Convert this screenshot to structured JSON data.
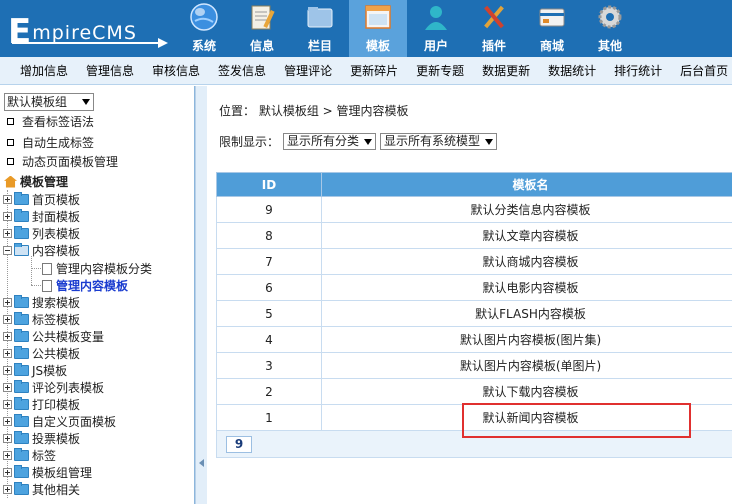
{
  "app": {
    "logo_prefix": "E",
    "logo_rest": "mpireCMS"
  },
  "nav": [
    {
      "label": "系统",
      "icon": "globe-icon",
      "active": false
    },
    {
      "label": "信息",
      "icon": "notepad-icon",
      "active": false
    },
    {
      "label": "栏目",
      "icon": "folder-icon",
      "active": false
    },
    {
      "label": "模板",
      "icon": "window-icon",
      "active": true
    },
    {
      "label": "用户",
      "icon": "user-icon",
      "active": false
    },
    {
      "label": "插件",
      "icon": "tools-icon",
      "active": false
    },
    {
      "label": "商城",
      "icon": "card-icon",
      "active": false
    },
    {
      "label": "其他",
      "icon": "gear-icon",
      "active": false
    }
  ],
  "menubar": [
    "增加信息",
    "管理信息",
    "审核信息",
    "签发信息",
    "管理评论",
    "更新碎片",
    "更新专题",
    "数据更新",
    "数据统计",
    "排行统计",
    "后台首页"
  ],
  "sidebar": {
    "template_group_select": "默认模板组",
    "links": [
      "查看标签语法",
      "自动生成标签",
      "动态页面模板管理"
    ],
    "tree_root": "模板管理",
    "tree_before": [
      "首页模板",
      "封面模板",
      "列表模板"
    ],
    "tree_open": "内容模板",
    "tree_open_children": [
      "管理内容模板分类",
      "管理内容模板"
    ],
    "tree_after": [
      "搜索模板",
      "标签模板",
      "公共模板变量",
      "公共模板",
      "JS模板",
      "评论列表模板",
      "打印模板",
      "自定义页面模板",
      "投票模板",
      "标签",
      "模板组管理",
      "其他相关"
    ]
  },
  "main": {
    "location_label": "位置：",
    "location_path": "默认模板组 > 管理内容模板",
    "filter_label": "限制显示：",
    "filter_class": "显示所有分类",
    "filter_model": "显示所有系统模型",
    "table_headers": [
      "ID",
      "模板名"
    ],
    "rows": [
      {
        "id": "9",
        "name": "默认分类信息内容模板"
      },
      {
        "id": "8",
        "name": "默认文章内容模板"
      },
      {
        "id": "7",
        "name": "默认商城内容模板"
      },
      {
        "id": "6",
        "name": "默认电影内容模板"
      },
      {
        "id": "5",
        "name": "默认FLASH内容模板"
      },
      {
        "id": "4",
        "name": "默认图片内容模板(图片集)"
      },
      {
        "id": "3",
        "name": "默认图片内容模板(单图片)"
      },
      {
        "id": "2",
        "name": "默认下载内容模板"
      },
      {
        "id": "1",
        "name": "默认新闻内容模板"
      }
    ],
    "pagination_total": "9"
  },
  "colors": {
    "header_bg": "#1e6fb4",
    "active_nav_bg": "#5aa2dc",
    "table_header_bg": "#4f9dd8",
    "highlight": "#e0302f"
  }
}
